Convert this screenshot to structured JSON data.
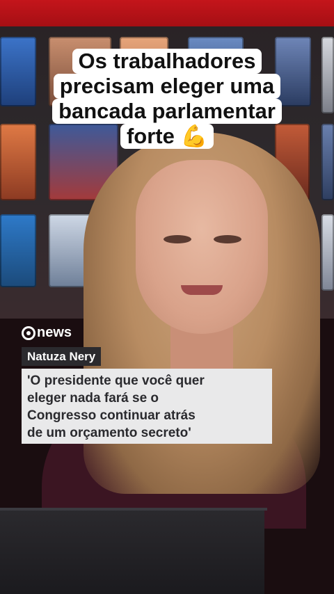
{
  "caption": {
    "lines": [
      "Os trabalhadores",
      "precisam eleger uma",
      "bancada parlamentar",
      "forte 💪"
    ]
  },
  "lower_third": {
    "channel_logo_text": "news",
    "name": "Natuza Nery",
    "quote_lines": [
      "'O presidente que você quer",
      "eleger nada fará se o",
      "Congresso continuar atrás",
      "de um orçamento secreto'"
    ]
  },
  "colors": {
    "brand_red": "#c4151b",
    "caption_bg": "#ffffff",
    "name_tag_bg": "#2b2a2e",
    "quote_bg": "#e9e9ea"
  }
}
